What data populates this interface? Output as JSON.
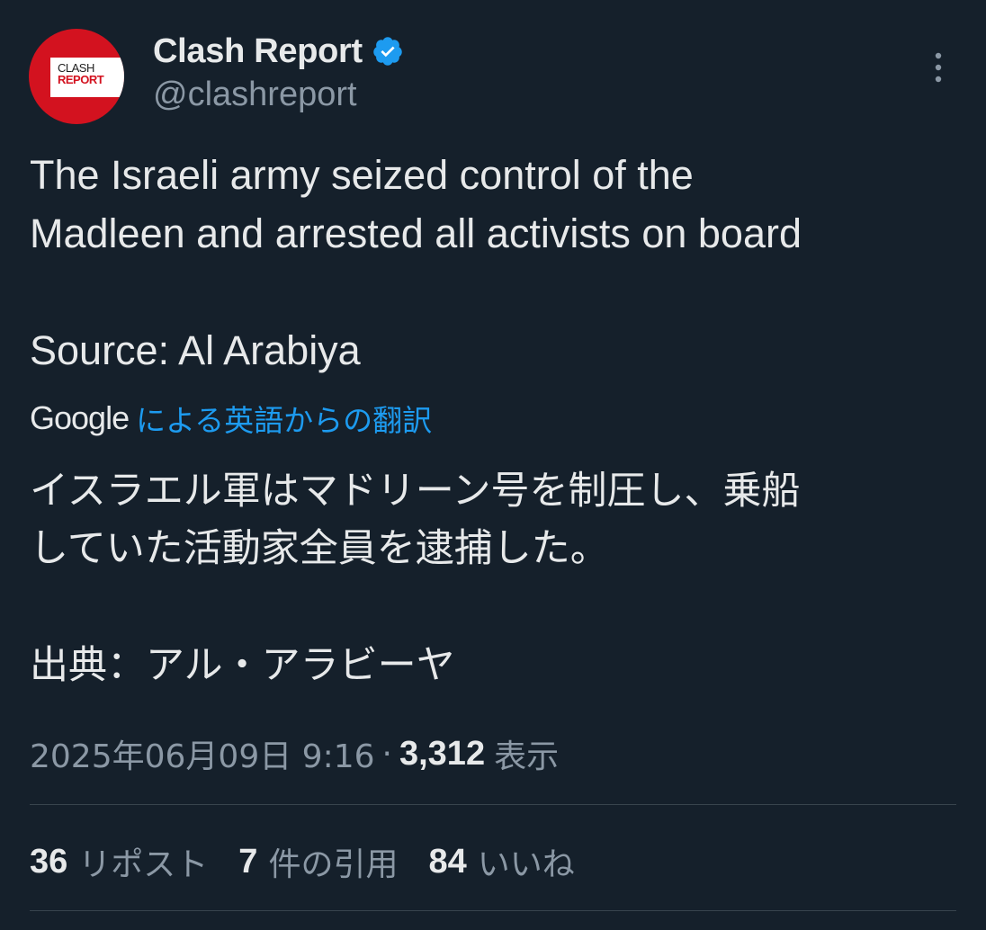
{
  "author": {
    "display_name": "Clash Report",
    "handle": "@clashreport",
    "avatar_text_line1": "CLASH",
    "avatar_text_line2": "REPORT",
    "verified_icon": "verified-badge-icon"
  },
  "tweet": {
    "text": "The Israeli army seized control of the\nMadleen and arrested all activists on board",
    "source_line": "Source: Al Arabiya"
  },
  "translation": {
    "provider": "Google",
    "link_label": "による英語からの翻訳",
    "text": "イスラエル軍はマドリーン号を制圧し、乗船\nしていた活動家全員を逮捕した。",
    "source_line": "出典：アル・アラビーヤ"
  },
  "meta": {
    "timestamp": "2025年06月09日 9:16",
    "separator": "·",
    "views_count": "3,312",
    "views_label": "表示"
  },
  "stats": {
    "reposts_count": "36",
    "reposts_label": "リポスト",
    "quotes_count": "7",
    "quotes_label": "件の引用",
    "likes_count": "84",
    "likes_label": "いいね"
  },
  "colors": {
    "background": "#15202b",
    "text": "#e7e9ea",
    "secondary_text": "#8b98a5",
    "accent": "#1d9bf0",
    "avatar_red": "#d3121f",
    "divider": "#38444d"
  }
}
